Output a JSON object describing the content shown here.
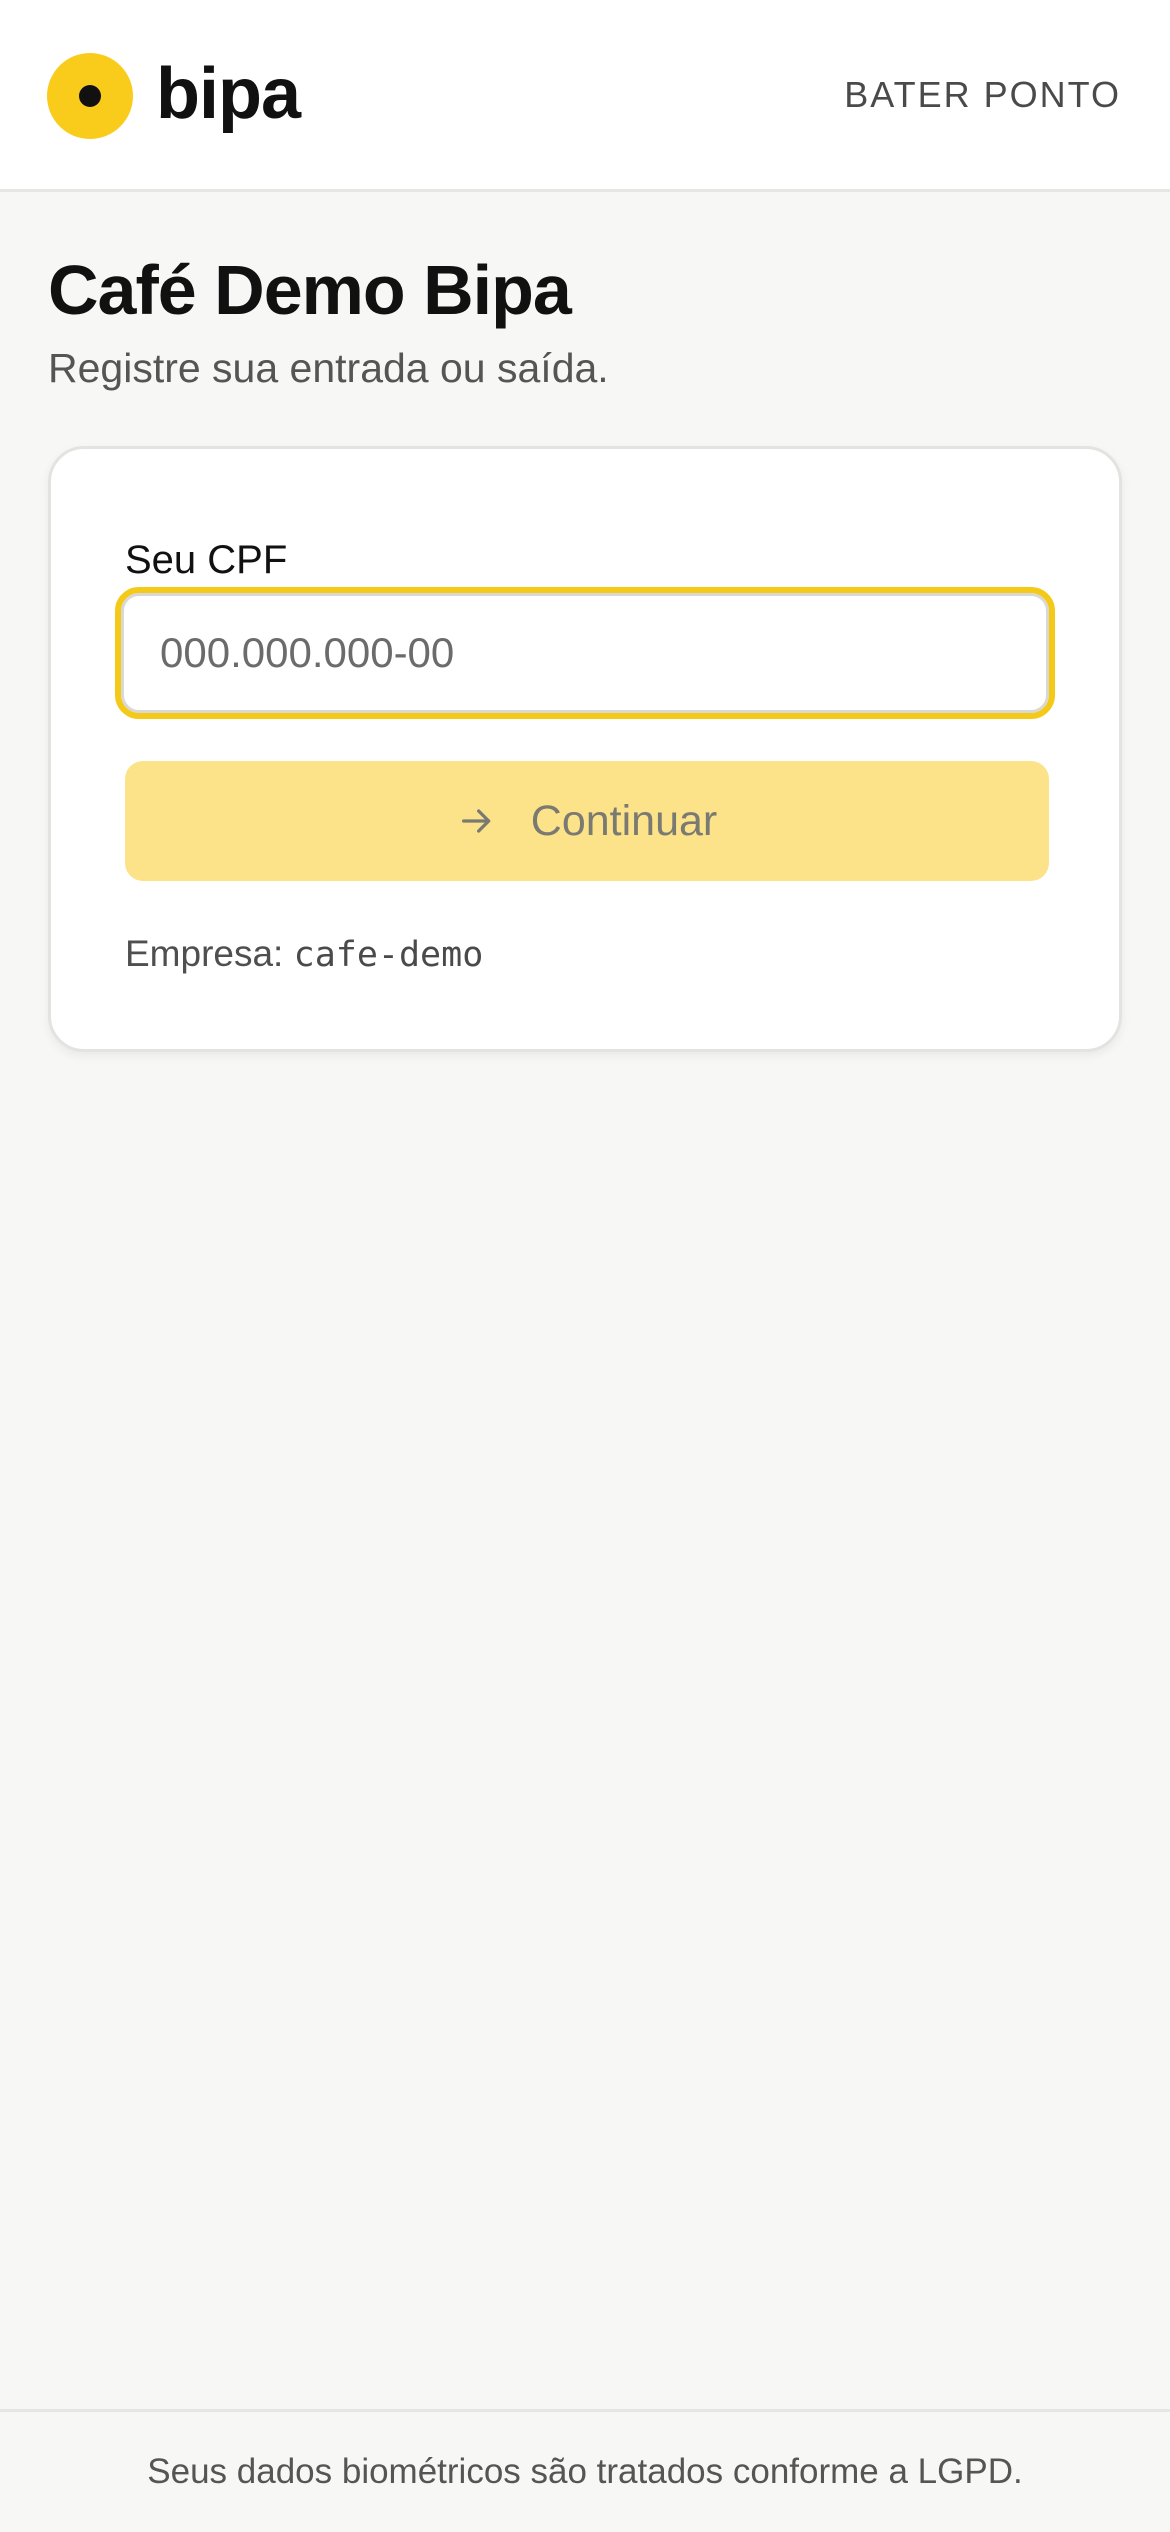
{
  "header": {
    "brand": "bipa",
    "nav_link": "BATER PONTO"
  },
  "main": {
    "title": "Café Demo Bipa",
    "subtitle": "Registre sua entrada ou saída."
  },
  "form": {
    "cpf_label": "Seu CPF",
    "cpf_value": "",
    "cpf_placeholder": "000.000.000-00",
    "continue_label": "Continuar",
    "company_label": "Empresa:",
    "company_code": "cafe-demo"
  },
  "footer": {
    "text": "Seus dados biométricos são tratados conforme a LGPD."
  },
  "colors": {
    "brand_yellow": "#f9cc1c",
    "button_disabled": "#fce38a",
    "focus_ring": "#f5c917",
    "background": "#f7f7f5"
  },
  "icons": {
    "logo": "yellow-circle-dot-logo-icon",
    "continue": "arrow-right-icon"
  }
}
